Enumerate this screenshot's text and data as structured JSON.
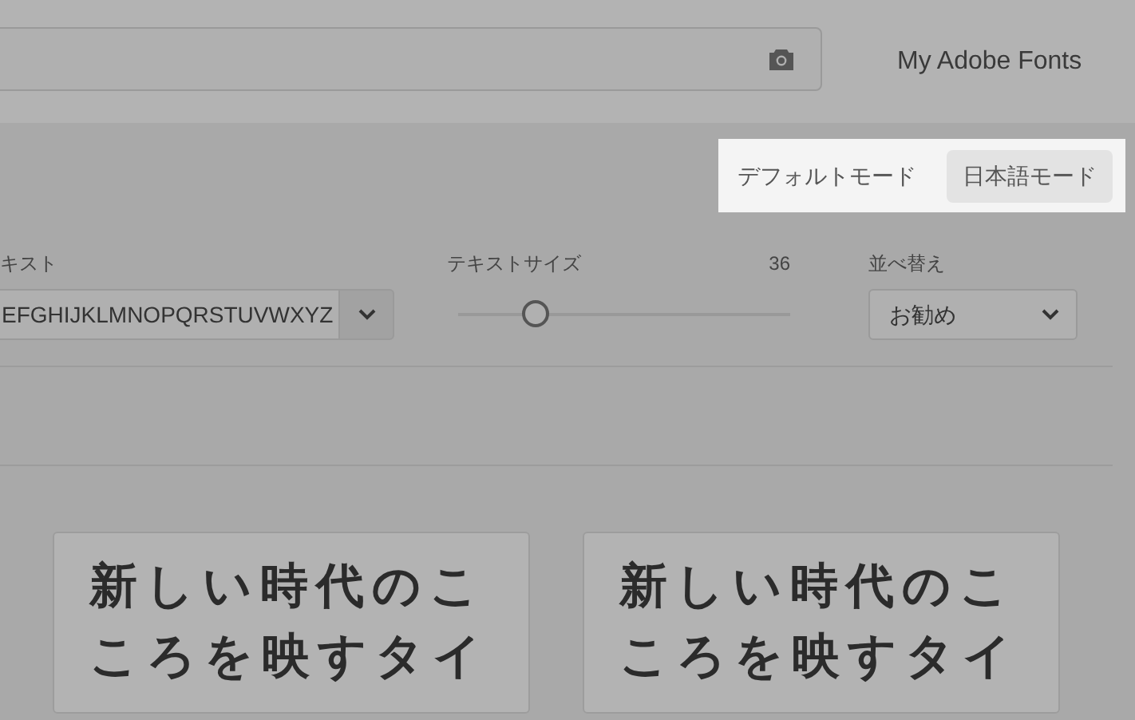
{
  "header": {
    "nav_link": "My Adobe Fonts"
  },
  "mode_switch": [
    {
      "label": "デフォルトモード",
      "selected": false
    },
    {
      "label": "日本語モード",
      "selected": true
    }
  ],
  "sample_text": {
    "label": "キスト",
    "value": "EFGHIJKLMNOPQRSTUVWXYZ"
  },
  "text_size": {
    "label": "テキストサイズ",
    "reading": "36",
    "level": 0.23
  },
  "sort": {
    "label": "並べ替え",
    "value": "お勧め"
  },
  "cards": [
    {
      "sample": "新しい時代のこころを映すタイ"
    },
    {
      "sample": "新しい時代のこころを映すタイ"
    }
  ]
}
